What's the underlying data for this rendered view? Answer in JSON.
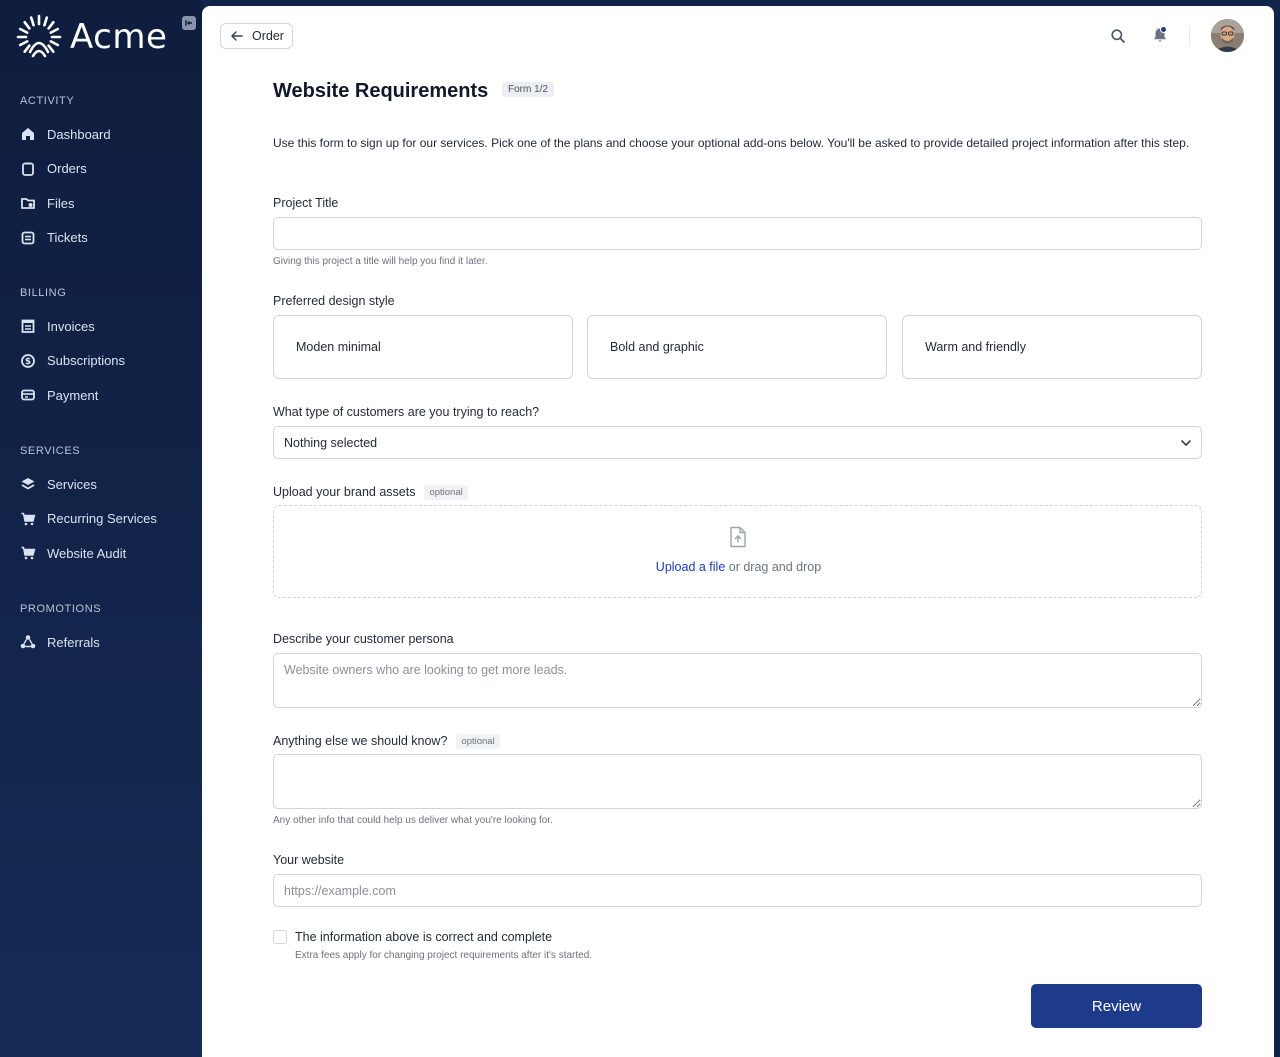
{
  "brand": {
    "name": "Acme",
    "logo_icon": "sunburst-logo-icon",
    "collapse_icon": "collapse-sidebar-icon"
  },
  "sidebar": {
    "sections": [
      {
        "header": "ACTIVITY",
        "items": [
          {
            "label": "Dashboard",
            "icon": "home-icon"
          },
          {
            "label": "Orders",
            "icon": "orders-icon"
          },
          {
            "label": "Files",
            "icon": "files-icon"
          },
          {
            "label": "Tickets",
            "icon": "tickets-icon"
          }
        ]
      },
      {
        "header": "BILLING",
        "items": [
          {
            "label": "Invoices",
            "icon": "invoice-icon"
          },
          {
            "label": "Subscriptions",
            "icon": "subscription-icon"
          },
          {
            "label": "Payment",
            "icon": "credit-card-icon"
          }
        ]
      },
      {
        "header": "SERVICES",
        "items": [
          {
            "label": "Services",
            "icon": "layers-icon"
          },
          {
            "label": "Recurring Services",
            "icon": "cart-icon"
          },
          {
            "label": "Website Audit",
            "icon": "cart-icon"
          }
        ]
      },
      {
        "header": "PROMOTIONS",
        "items": [
          {
            "label": "Referrals",
            "icon": "referrals-icon"
          }
        ]
      }
    ]
  },
  "topbar": {
    "back_label": "Order",
    "search_icon": "search-icon",
    "bell_icon": "bell-icon"
  },
  "form": {
    "title": "Website Requirements",
    "badge": "Form 1/2",
    "intro": "Use this form to sign up for our services. Pick one of the plans and choose your optional add-ons below. You'll be asked to provide detailed project information after this step.",
    "project_title": {
      "label": "Project Title",
      "value": "",
      "help": "Giving this project a title will help you find it later."
    },
    "design_style": {
      "label": "Preferred design style",
      "options": [
        "Moden minimal",
        "Bold and graphic",
        "Warm and friendly"
      ]
    },
    "customers": {
      "label": "What type of customers are you trying to reach?",
      "selected": "Nothing selected"
    },
    "brand_assets": {
      "label": "Upload your brand assets",
      "optional": "optional",
      "upload_link": "Upload a file",
      "upload_rest": " or drag and drop"
    },
    "persona": {
      "label": "Describe your customer persona",
      "placeholder": "Website owners who are looking to get more leads."
    },
    "anything_else": {
      "label": "Anything else we should know?",
      "optional": "optional",
      "help": "Any other info that could help us deliver what you're looking for."
    },
    "website": {
      "label": "Your website",
      "placeholder": "https://example.com"
    },
    "confirm": {
      "label": "The information above is correct and complete",
      "help": "Extra fees apply for changing project requirements after it's started.",
      "checked": false
    },
    "submit_label": "Review"
  },
  "colors": {
    "sidebar_bg": "#12234a",
    "accent": "#1e3a8a",
    "link": "#1e40af"
  }
}
